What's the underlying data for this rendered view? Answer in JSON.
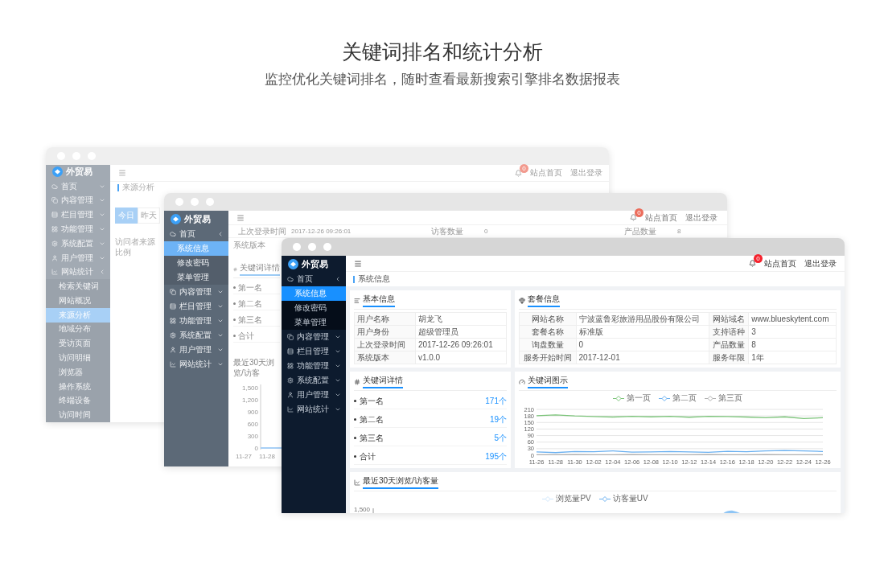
{
  "header": {
    "title": "关键词排名和统计分析",
    "subtitle": "监控优化关键词排名，随时查看最新搜索引擎排名数据报表"
  },
  "back_window": {
    "brand": "外贸易",
    "badge": "0",
    "top_links": [
      "站点首页",
      "退出登录"
    ],
    "nav": [
      {
        "label": "首页",
        "expanded": false
      },
      {
        "label": "内容管理",
        "expanded": false
      },
      {
        "label": "栏目管理",
        "expanded": false
      },
      {
        "label": "功能管理",
        "expanded": false
      },
      {
        "label": "系统配置",
        "expanded": false
      },
      {
        "label": "用户管理",
        "expanded": false
      },
      {
        "label": "网站统计",
        "expanded": true,
        "children": [
          {
            "label": "检索关键词",
            "selected": false
          },
          {
            "label": "网站概况",
            "selected": false
          },
          {
            "label": "来源分析",
            "selected": true
          },
          {
            "label": "地域分布",
            "selected": false
          },
          {
            "label": "受访页面",
            "selected": false
          },
          {
            "label": "访问明细",
            "selected": false
          },
          {
            "label": "浏览器",
            "selected": false
          },
          {
            "label": "操作系统",
            "selected": false
          },
          {
            "label": "终端设备",
            "selected": false
          },
          {
            "label": "访问时间",
            "selected": false
          }
        ]
      }
    ],
    "breadcrumb": "来源分析",
    "tabs": [
      {
        "label": "今日",
        "selected": true
      },
      {
        "label": "昨天",
        "selected": false
      }
    ],
    "panel_title": "访问者来源比例"
  },
  "middle_window": {
    "brand": "外贸易",
    "badge": "0",
    "top_links": [
      "站点首页",
      "退出登录"
    ],
    "nav": [
      {
        "label": "首页",
        "expanded": true,
        "children": [
          {
            "label": "系统信息",
            "selected": true
          },
          {
            "label": "修改密码",
            "selected": false
          },
          {
            "label": "菜单管理",
            "selected": false
          }
        ]
      },
      {
        "label": "内容管理",
        "expanded": false
      },
      {
        "label": "栏目管理",
        "expanded": false
      },
      {
        "label": "功能管理",
        "expanded": false
      },
      {
        "label": "系统配置",
        "expanded": false
      },
      {
        "label": "用户管理",
        "expanded": false
      },
      {
        "label": "网站统计",
        "expanded": false
      }
    ],
    "stats": [
      {
        "label": "上次登录时间",
        "value": "2017-12-26 09:26:01"
      },
      {
        "label": "访客数量",
        "value": "0"
      },
      {
        "label": "产品数量",
        "value": "8"
      }
    ],
    "version_label": "系统版本",
    "keyword_title": "关键词详情",
    "keyword_items": [
      "第一名",
      "第二名",
      "第三名",
      "合计"
    ],
    "traffic_title": "最近30天浏览/访客",
    "traffic_yticks": [
      "1,500",
      "1,200",
      "900",
      "600",
      "300",
      "0"
    ],
    "traffic_xticks": [
      "11-27",
      "11-28"
    ]
  },
  "front_window": {
    "brand": "外贸易",
    "badge": "0",
    "top_links": [
      "站点首页",
      "退出登录"
    ],
    "nav": [
      {
        "label": "首页",
        "expanded": true,
        "children": [
          {
            "label": "系统信息",
            "selected": true
          },
          {
            "label": "修改密码",
            "selected": false
          },
          {
            "label": "菜单管理",
            "selected": false
          }
        ]
      },
      {
        "label": "内容管理",
        "expanded": false
      },
      {
        "label": "栏目管理",
        "expanded": false
      },
      {
        "label": "功能管理",
        "expanded": false
      },
      {
        "label": "系统配置",
        "expanded": false
      },
      {
        "label": "用户管理",
        "expanded": false
      },
      {
        "label": "网站统计",
        "expanded": false
      }
    ],
    "breadcrumb": "系统信息",
    "basic_info": {
      "title": "基本信息",
      "rows": [
        {
          "label": "用户名称",
          "value": "胡龙飞"
        },
        {
          "label": "用户身份",
          "value": "超级管理员"
        },
        {
          "label": "上次登录时间",
          "value": "2017-12-26 09:26:01"
        },
        {
          "label": "系统版本",
          "value": "v1.0.0"
        }
      ]
    },
    "package_info": {
      "title": "套餐信息",
      "rows": [
        {
          "label": "网站名称",
          "value": "宁波蓝鲁彩旅游用品股份有限公司",
          "label_2": "网站域名",
          "value_2": "www.blueskytent.com"
        },
        {
          "label": "套餐名称",
          "value": "标准版",
          "label_2": "支持语种",
          "value_2": "3"
        },
        {
          "label": "询盘数量",
          "value": "0",
          "label_2": "产品数量",
          "value_2": "8"
        },
        {
          "label": "服务开始时间",
          "value": "2017-12-01",
          "label_2": "服务年限",
          "value_2": "1年"
        }
      ]
    },
    "keyword_detail": {
      "title": "关键词详情",
      "items": [
        {
          "label": "第一名",
          "count": "171个"
        },
        {
          "label": "第二名",
          "count": "19个"
        },
        {
          "label": "第三名",
          "count": "5个"
        },
        {
          "label": "合计",
          "count": "195个"
        }
      ]
    },
    "keyword_chart": {
      "title": "关键词图示",
      "chart_data": {
        "type": "line",
        "grid": true,
        "categories": [
          "11-26",
          "11-28",
          "11-30",
          "12-02",
          "12-04",
          "12-06",
          "12-08",
          "12-10",
          "12-12",
          "12-14",
          "12-16",
          "12-18",
          "12-20",
          "12-22",
          "12-24",
          "12-26"
        ],
        "ylim": [
          0,
          210
        ],
        "yticks": [
          0,
          30,
          60,
          90,
          120,
          150,
          180,
          210
        ],
        "series": [
          {
            "name": "第一页",
            "color": "#7cc47a",
            "values": [
              181,
              185,
              180,
              177,
              175,
              178,
              176,
              178,
              174,
              178,
              177,
              175,
              172,
              176,
              168,
              172
            ]
          },
          {
            "name": "第二页",
            "color": "#6ab0f0",
            "values": [
              15,
              12,
              17,
              16,
              20,
              14,
              15,
              17,
              15,
              13,
              18,
              16,
              20,
              22,
              20,
              17
            ]
          },
          {
            "name": "第三页",
            "color": "#b0b0b0",
            "values": [
              2,
              2,
              3,
              2,
              2,
              3,
              2,
              2,
              2,
              3,
              2,
              2,
              3,
              2,
              2,
              2
            ]
          }
        ]
      }
    },
    "traffic": {
      "title": "最近30天浏览/访客量",
      "legend": [
        "浏览量PV",
        "访客量UV"
      ],
      "top_tick": "1,500"
    }
  }
}
